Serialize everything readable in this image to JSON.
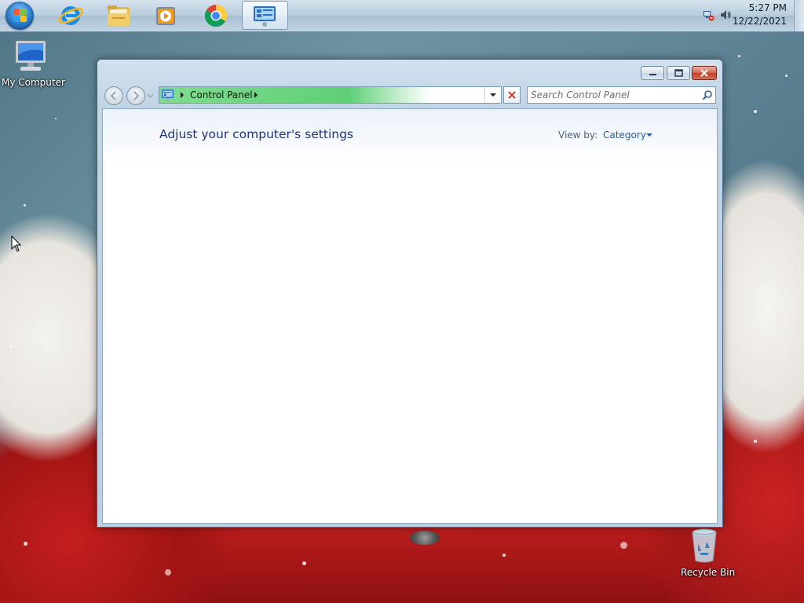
{
  "taskbar": {
    "pinned": [
      {
        "name": "internet-explorer-icon"
      },
      {
        "name": "file-explorer-icon"
      },
      {
        "name": "media-player-icon"
      },
      {
        "name": "chrome-icon"
      },
      {
        "name": "control-panel-icon"
      }
    ],
    "tray": {
      "network_icon": "network-icon",
      "volume_icon": "volume-icon",
      "time": "5:27 PM",
      "date": "12/22/2021"
    }
  },
  "desktop": {
    "icons": [
      {
        "label": "My Computer",
        "icon": "computer-icon"
      },
      {
        "label": "Recycle Bin",
        "icon": "recycle-bin-icon"
      }
    ]
  },
  "window": {
    "address": {
      "crumbs": [
        "Control Panel"
      ]
    },
    "search": {
      "placeholder": "Search Control Panel"
    },
    "content": {
      "title": "Adjust your computer's settings",
      "view_by_label": "View by:",
      "view_by_value": "Category"
    }
  },
  "colors": {
    "title_text": "#1e3287",
    "link_text": "#1e5bb3",
    "address_progress": "#5fd077"
  }
}
